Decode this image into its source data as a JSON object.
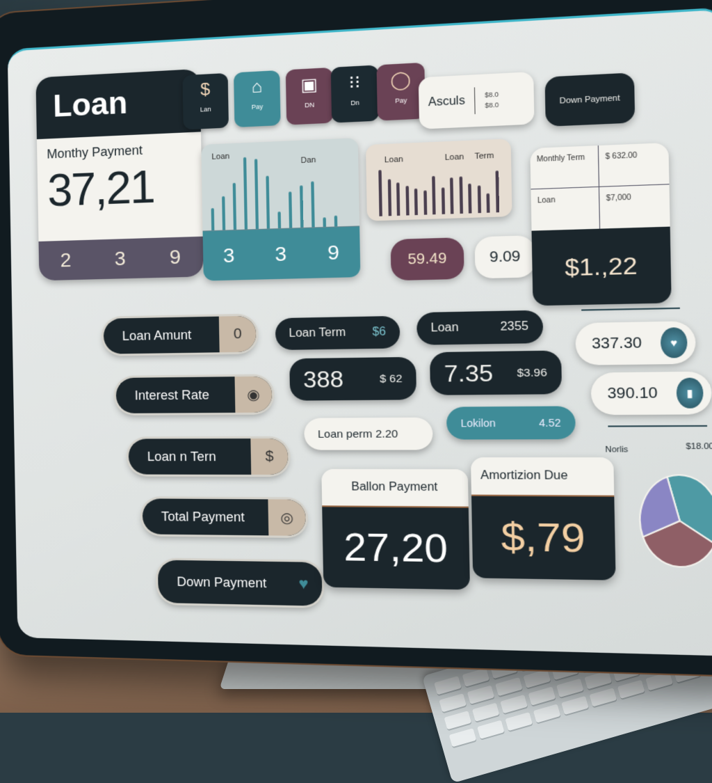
{
  "app": {
    "title": "Loan",
    "monthly_payment_label": "Monthy Payment",
    "monthly_payment_value": "37,21",
    "monthly_footer_digits": [
      "2",
      "3",
      "9"
    ]
  },
  "toolbar": {
    "items": [
      {
        "icon": "dollar-icon",
        "glyph": "$",
        "label": "Lan",
        "color": "#1c2a31"
      },
      {
        "icon": "folder-icon",
        "glyph": "⌂",
        "label": "Pay",
        "color": "#3f8c98"
      },
      {
        "icon": "calculator-icon",
        "glyph": "▣",
        "label": "DN",
        "color": "#6a4255"
      },
      {
        "icon": "settings-icon",
        "glyph": "⁝⁝",
        "label": "Dn",
        "color": "#1c2a31"
      },
      {
        "icon": "clock-icon",
        "glyph": "◯",
        "label": "Pay",
        "color": "#6a4255"
      }
    ],
    "results_label": "Asculs",
    "results_mini": [
      "$8.0",
      "$8.0"
    ],
    "down_payment_button": "Down Payment"
  },
  "chart_panel_1": {
    "labels": [
      "Loan",
      "Dan"
    ],
    "footer_digits": [
      "3",
      "3",
      "9"
    ]
  },
  "chart_panel_2": {
    "labels": [
      "Loan",
      "Loan",
      "Term"
    ]
  },
  "chart_data": [
    {
      "type": "bar",
      "title": "",
      "legend": [
        "Loan",
        "Dan"
      ],
      "values": [
        30,
        45,
        62,
        95,
        92,
        70,
        22,
        48,
        55,
        60,
        12,
        14
      ],
      "ylim": [
        0,
        100
      ]
    },
    {
      "type": "bar",
      "title": "",
      "legend": [
        "Loan",
        "Loan",
        "Term"
      ],
      "values": [
        88,
        70,
        62,
        55,
        50,
        46,
        72,
        50,
        68,
        70,
        56,
        52,
        36,
        78
      ],
      "ylim": [
        0,
        100
      ]
    },
    {
      "type": "pie",
      "title": "Norlis",
      "values": [
        38,
        36,
        26
      ],
      "colors": [
        "#4e9aa4",
        "#8f5f66",
        "#8a86c4"
      ]
    }
  ],
  "value_pills": [
    "59.49",
    "9.09"
  ],
  "summary": {
    "cells": [
      "Monthly Term",
      "$ 632.00",
      "Loan",
      "$7,000"
    ],
    "total": "$1.,22"
  },
  "inputs": [
    {
      "label": "Loan Amunt",
      "tag_glyph": "0"
    },
    {
      "label": "Interest Rate",
      "tag_glyph": "◉"
    },
    {
      "label": "Loan n Tern",
      "tag_glyph": "$"
    },
    {
      "label": "Total Payment",
      "tag_glyph": "◎"
    },
    {
      "label": "Down Payment",
      "tag_glyph": "♥"
    }
  ],
  "middle": {
    "loan_term": {
      "label": "Loan Term",
      "value": "$6"
    },
    "loan": {
      "label": "Loan",
      "value": "2355"
    },
    "big_left": {
      "value": "388",
      "sub": "$ 62"
    },
    "big_right": {
      "value": "7.35",
      "sub": "$3.96"
    },
    "loan_perm": "Loan perm 2.20",
    "lokilon": {
      "label": "Lokilon",
      "value": "4.52"
    }
  },
  "stats": {
    "balloon": {
      "label": "Ballon Payment",
      "value": "27,20"
    },
    "amortization": {
      "label": "Amortizion Due",
      "value": "$,79"
    }
  },
  "right": {
    "pill1": "337.30",
    "pill2": "390.10",
    "pie_label": "Norlis",
    "pie_value": "$18.00"
  }
}
